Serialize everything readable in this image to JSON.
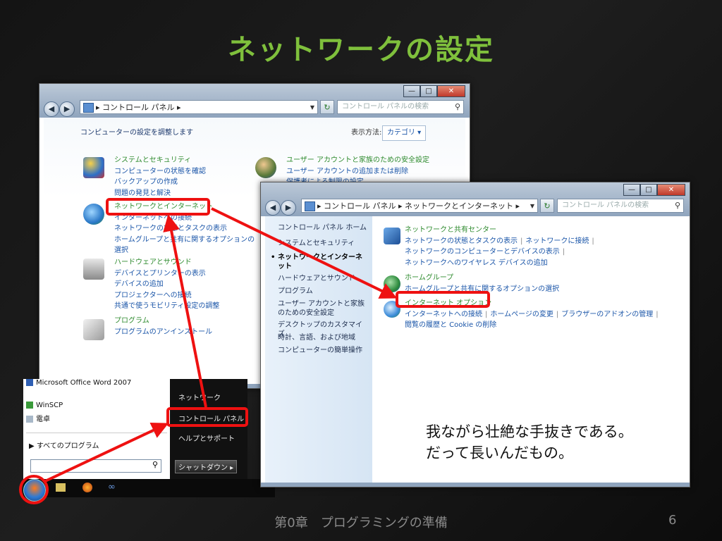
{
  "slide": {
    "title": "ネットワークの設定",
    "footer": "第0章　プログラミングの準備",
    "page_number": "6"
  },
  "window1": {
    "breadcrumb": "▸ コントロール パネル ▸",
    "search_placeholder": "コントロール パネルの検索",
    "heading": "コンピューターの設定を調整します",
    "view_label": "表示方法:",
    "view_value": "カテゴリ ▾",
    "categories": [
      {
        "title": "システムとセキュリティ",
        "links": [
          "コンピューターの状態を確認",
          "バックアップの作成",
          "問題の発見と解決"
        ]
      },
      {
        "title": "ネットワークとインターネット",
        "links": [
          "インターネットへの接続",
          "ネットワークの状態とタスクの表示",
          "ホームグループと共有に関するオプションの",
          "選択"
        ]
      },
      {
        "title": "ハードウェアとサウンド",
        "links": [
          "デバイスとプリンターの表示",
          "デバイスの追加",
          "プロジェクターへの接続",
          "共通で使うモビリティ設定の調整"
        ]
      },
      {
        "title": "プログラム",
        "links": [
          "プログラムのアンインストール"
        ]
      }
    ],
    "right": {
      "title": "ユーザー アカウントと家族のための安全設定",
      "links": [
        "ユーザー アカウントの追加または削除",
        "保護者による制限の設定"
      ]
    }
  },
  "window2": {
    "breadcrumb": "▸ コントロール パネル ▸ ネットワークとインターネット ▸",
    "search_placeholder": "コントロール パネルの検索",
    "sidebar": [
      "コントロール パネル ホーム",
      "システムとセキュリティ",
      "ネットワークとインターネット",
      "ハードウェアとサウンド",
      "プログラム",
      "ユーザー アカウントと家族のための安全設定",
      "デスクトップのカスタマイズ",
      "時計、言語、および地域",
      "コンピューターの簡単操作"
    ],
    "sections": [
      {
        "title": "ネットワークと共有センター",
        "links": [
          "ネットワークの状態とタスクの表示",
          "ネットワークに接続",
          "ネットワークのコンピューターとデバイスの表示",
          "ネットワークへのワイヤレス デバイスの追加"
        ]
      },
      {
        "title": "ホームグループ",
        "links": [
          "ホームグループと共有に関するオプションの選択"
        ]
      },
      {
        "title": "インターネット オプション",
        "links": [
          "インターネットへの接続",
          "ホームページの変更",
          "ブラウザーのアドオンの管理",
          "閲覧の履歴と Cookie の削除"
        ]
      }
    ]
  },
  "start_menu": {
    "left_items": [
      "Microsoft Office Word 2007",
      "WinSCP",
      "電卓"
    ],
    "all_programs": "すべてのプログラム",
    "right_items": [
      "ネットワーク",
      "コントロール パネル",
      "ヘルプとサポート"
    ],
    "shutdown": "シャットダウン"
  },
  "note": {
    "line1": "我ながら壮絶な手抜きである。",
    "line2": "だって長いんだもの。"
  },
  "colors": {
    "title_green": "#7fc03c",
    "highlight_red": "#ee1111",
    "link_blue": "#1a55a8",
    "heading_green": "#2e8b2e"
  }
}
